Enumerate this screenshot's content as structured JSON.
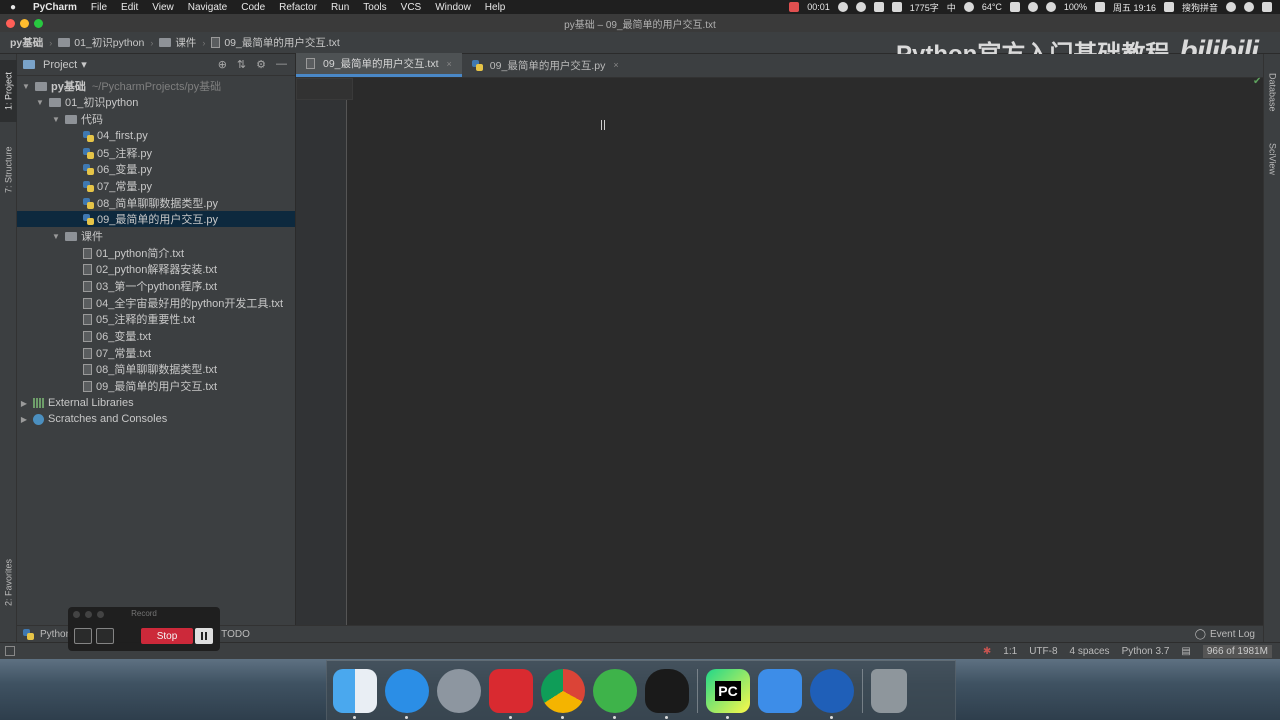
{
  "menubar": {
    "apple": "",
    "items": [
      "PyCharm",
      "File",
      "Edit",
      "View",
      "Navigate",
      "Code",
      "Refactor",
      "Run",
      "Tools",
      "VCS",
      "Window",
      "Help"
    ],
    "status": {
      "timer": "00:01",
      "chars": "1775字",
      "input_lang": "中",
      "temp": "64°C",
      "battery": "100%",
      "clock": "周五 19:16",
      "ime": "搜狗拼音"
    }
  },
  "window": {
    "title": "py基础 – 09_最简单的用户交互.txt"
  },
  "breadcrumb": [
    "py基础",
    "01_初识python",
    "课件",
    "09_最简单的用户交互.txt"
  ],
  "watermark": {
    "text": "Python官方入门基础教程",
    "logo": "bilibili"
  },
  "left_strip": {
    "project_tab": "1: Project",
    "structure_tab": "7: Structure",
    "favorites_tab": "2: Favorites"
  },
  "project": {
    "title": "Project",
    "root": {
      "name": "py基础",
      "path": "~/PycharmProjects/py基础"
    },
    "folder1": "01_初识python",
    "code_folder": "代码",
    "code_files": [
      "04_first.py",
      "05_注释.py",
      "06_变量.py",
      "07_常量.py",
      "08_简单聊聊数据类型.py",
      "09_最简单的用户交互.py"
    ],
    "courseware_folder": "课件",
    "courseware_files": [
      "01_python简介.txt",
      "02_python解释器安装.txt",
      "03_第一个python程序.txt",
      "04_全宇宙最好用的python开发工具.txt",
      "05_注释的重要性.txt",
      "06_变量.txt",
      "07_常量.txt",
      "08_简单聊聊数据类型.txt",
      "09_最简单的用户交互.txt"
    ],
    "external_libraries": "External Libraries",
    "scratches": "Scratches and Consoles"
  },
  "editor": {
    "tabs": [
      {
        "label": "09_最简单的用户交互.txt",
        "active": true
      },
      {
        "label": "09_最简单的用户交互.py",
        "active": false
      }
    ],
    "close_glyph": "×"
  },
  "right_strip": {
    "database_tab": "Database",
    "sciview_tab": "SciView"
  },
  "bottom_tools": {
    "python_console": "Python",
    "todo": "TODO",
    "event_log": "Event Log"
  },
  "statusbar": {
    "position": "1:1",
    "encoding": "UTF-8",
    "indent": "4 spaces",
    "interpreter": "Python 3.7",
    "memory": "966 of 1981M"
  },
  "record_overlay": {
    "title": "Record",
    "stop_label": "Stop"
  },
  "dock": {
    "apps": [
      "finder",
      "safari",
      "launchpad",
      "netease-music",
      "chrome",
      "wechat",
      "qq",
      "pycharm",
      "pencil-app",
      "thunder",
      "trash"
    ],
    "pycharm_label": "PC"
  },
  "colors": {
    "accent": "#4a88c7",
    "selection": "#0d293e",
    "stop_red": "#d4283a"
  }
}
